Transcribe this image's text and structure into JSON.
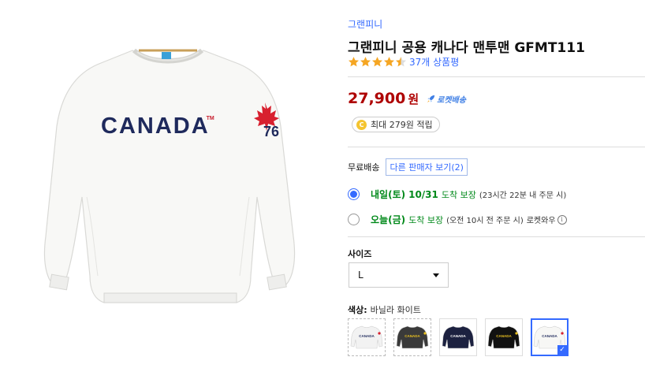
{
  "image": {
    "print_text": "CANADA",
    "trademark": "TM",
    "sleeve_number": "76"
  },
  "product": {
    "brand": "그랜피니",
    "title": "그랜피니 공용 캐나다 맨투맨 GFMT111",
    "rating": 4.5,
    "review_count": "37개 상품평"
  },
  "price": {
    "amount": "27,900",
    "currency": "원",
    "rocket_label": "로켓배송",
    "cash_reward": "최대 279원 적립",
    "cash_icon": "C"
  },
  "shipping": {
    "label": "무료배송",
    "other_sellers": "다른 판매자 보기(2)"
  },
  "delivery_options": [
    {
      "day": "내일(토)",
      "date": "10/31",
      "guarantee": "도착 보장",
      "note": "(23시간 22분 내 주문 시)",
      "extra": "",
      "selected": true
    },
    {
      "day": "오늘(금)",
      "date": "",
      "guarantee": "도착 보장",
      "note": "(오전 10시 전 주문 시)",
      "extra": "로켓와우",
      "selected": false
    }
  ],
  "size": {
    "label": "사이즈",
    "selected": "L"
  },
  "color": {
    "label": "색상:",
    "selected": "바닐라 화이트",
    "swatch_text": "CANADA",
    "swatches": [
      {
        "name": "white",
        "color": "#f2f2f2",
        "text_color": "#1f2a5c",
        "state": "soldout"
      },
      {
        "name": "charcoal",
        "color": "#3a3a3a",
        "text_color": "#e8c020",
        "state": "soldout"
      },
      {
        "name": "navy",
        "color": "#1c2140",
        "text_color": "#ffffff",
        "state": "normal"
      },
      {
        "name": "black",
        "color": "#111111",
        "text_color": "#e8c020",
        "state": "normal"
      },
      {
        "name": "vanilla-white",
        "color": "#f7f7f5",
        "text_color": "#1f2a5c",
        "state": "selected"
      }
    ]
  },
  "colors": {
    "accent": "#346aff",
    "price": "#ae0000",
    "delivery": "#00891a",
    "star": "#f5a623"
  }
}
